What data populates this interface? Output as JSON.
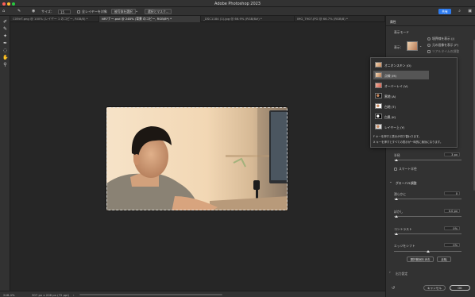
{
  "window": {
    "title": "Adobe Photoshop 2023",
    "traffic_colors": [
      "#fe5f57",
      "#febc2e",
      "#28c840"
    ]
  },
  "options_bar": {
    "size_label": "サイズ：",
    "size_value": "15",
    "sample_all_layers": "全レイヤーを対象",
    "auto_enhance": "被写体を選択",
    "select_and_mask": "選択とマスク...",
    "share": "共有"
  },
  "tabs": [
    {
      "label": "C05trT.png @ 100% (レイヤー 1 のコピー, RGB/8) *",
      "active": false
    },
    {
      "label": "NR7ナー.psd @ 248% (背景 のコピー, RGB/8*) *",
      "active": true
    },
    {
      "label": "_DSC1184 (1).jpg @ 66.9% (RGB/8#) *",
      "active": false
    },
    {
      "label": "IMG_7907.JPG @ 66.7% (RGB/8) *",
      "active": false
    }
  ],
  "tools": [
    "brush-icon",
    "quick-select-icon",
    "magic-wand-icon",
    "pen-icon",
    "lasso-icon",
    "hand-icon",
    "zoom-icon"
  ],
  "status": {
    "zoom": "248.4%",
    "doc_size": "307 px x 206 px (72 ppi)"
  },
  "right_panel": {
    "header": "属性",
    "view_mode_label": "表示モード",
    "view_label": "表示：",
    "show_edge": "境界線を表示 (J)",
    "show_original": "元の画像を表示 (P)",
    "realtime_refine": "リアルタイムの調整",
    "high_quality_preview": "高品質プレビュー",
    "radius_label": "半径",
    "radius_value": "3 px",
    "smart_radius": "スマート半径",
    "global_refine": "グローバル調整",
    "smooth_label": "滑らかに",
    "smooth_value": "0",
    "feather_label": "ぼかし",
    "feather_value": "0.0 px",
    "contrast_label": "コントラスト",
    "contrast_value": "0%",
    "shift_edge_label": "エッジをシフト",
    "shift_edge_value": "0%",
    "clear_selection": "選択範囲を消去",
    "invert": "反転",
    "output_settings": "出力設定",
    "cancel": "キャンセル",
    "ok": "OK"
  },
  "view_dropdown": {
    "items": [
      {
        "label": "オニオンスキン (O)",
        "selected": false
      },
      {
        "label": "点線 (M)",
        "selected": true
      },
      {
        "label": "オーバーレイ (V)",
        "selected": false
      },
      {
        "label": "黒地 (A)",
        "selected": false
      },
      {
        "label": "白地 (T)",
        "selected": false
      },
      {
        "label": "白黒 (K)",
        "selected": false
      },
      {
        "label": "レイヤー上 (Y)",
        "selected": false
      }
    ],
    "hint_line1": "F キーを押すと表示が切り替わります。",
    "hint_line2": "X キーを押すとすべての表示が一時的に無効になります。"
  }
}
